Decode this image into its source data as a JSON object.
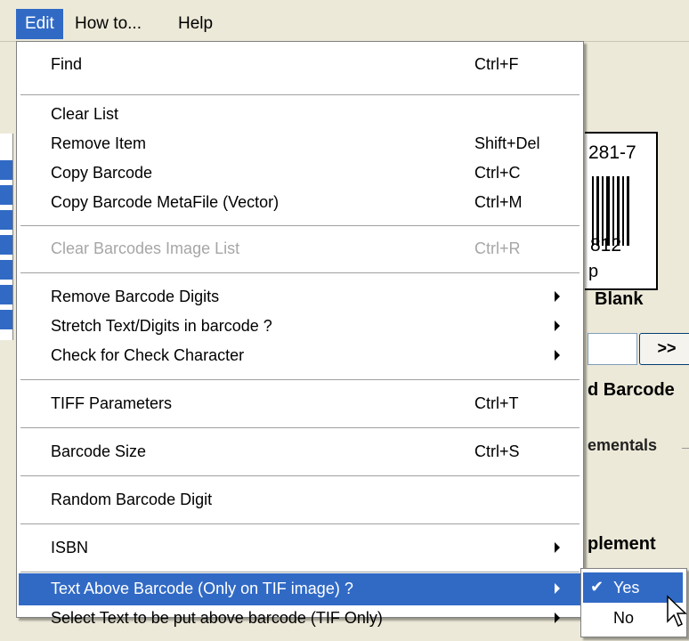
{
  "menubar": {
    "items": [
      "Edit",
      "How to...",
      "Help"
    ]
  },
  "edit_menu": {
    "find": {
      "label": "Find",
      "shortcut": "Ctrl+F"
    },
    "clear_list": {
      "label": "Clear List"
    },
    "remove_item": {
      "label": "Remove Item",
      "shortcut": "Shift+Del"
    },
    "copy_barcode": {
      "label": "Copy Barcode",
      "shortcut": "Ctrl+C"
    },
    "copy_metafile": {
      "label": "Copy Barcode MetaFile (Vector)",
      "shortcut": "Ctrl+M"
    },
    "clear_images": {
      "label": "Clear Barcodes Image List",
      "shortcut": "Ctrl+R"
    },
    "remove_digits": {
      "label": "Remove Barcode Digits"
    },
    "stretch_text": {
      "label": "Stretch Text/Digits in barcode ?"
    },
    "check_char": {
      "label": "Check for Check Character"
    },
    "tiff_params": {
      "label": "TIFF Parameters",
      "shortcut": "Ctrl+T"
    },
    "barcode_size": {
      "label": "Barcode Size",
      "shortcut": "Ctrl+S"
    },
    "random_digit": {
      "label": "Random Barcode Digit"
    },
    "isbn": {
      "label": "ISBN"
    },
    "text_above": {
      "label": "Text Above Barcode (Only on TIF image) ?"
    },
    "select_text": {
      "label": "Select Text to be put above barcode (TIF Only)"
    }
  },
  "submenu": {
    "yes": {
      "label": "Yes",
      "check": "✔"
    },
    "no": {
      "label": "No"
    }
  },
  "background": {
    "barcode_top": "281-7",
    "barcode_bottom": "812",
    "barcode_bottom2": "p",
    "blank_button": "Blank",
    "next_button": ">>",
    "label_barcode": "d Barcode",
    "label_supplementals": "ementals",
    "label_supplement": "plement"
  },
  "colors": {
    "highlight": "#316ac5",
    "menu_bg": "#ffffff",
    "window_bg": "#ece9d8"
  }
}
